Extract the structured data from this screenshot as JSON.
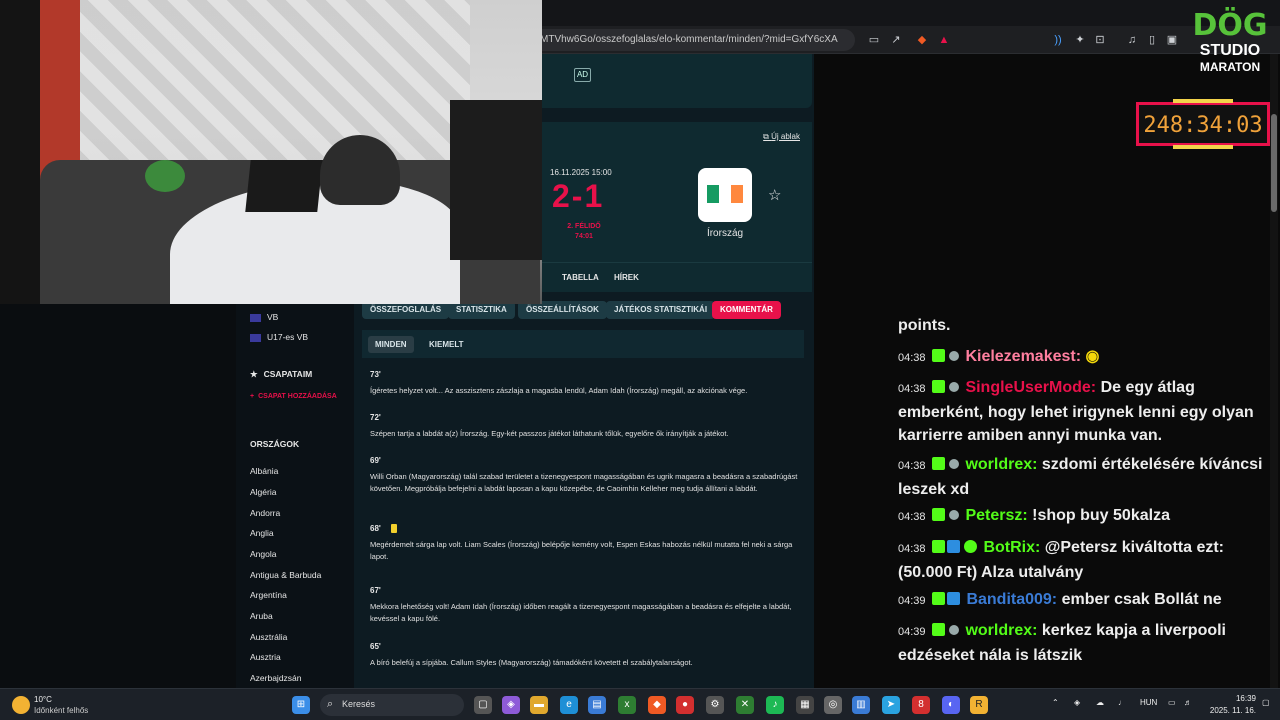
{
  "browser": {
    "url": "MTVhw6Go/osszefoglalas/elo-kommentar/minden/?mid=GxfY6cXA"
  },
  "ad": {
    "label": "AD"
  },
  "match": {
    "new_window": "Új ablak",
    "date": "16.11.2025 15:00",
    "score": "2-1",
    "period": "2. FÉLIDŐ",
    "clock": "74:01",
    "team": "Írország"
  },
  "subnav": [
    "TABELLA",
    "HÍREK"
  ],
  "tabs": [
    "ÖSSZEFOGLALÁS",
    "STATISZTIKA",
    "ÖSSZEÁLLÍTÁSOK",
    "JÁTÉKOS STATISZTIKÁI",
    "KOMMENTÁR"
  ],
  "filters": [
    "MINDEN",
    "KIEMELT"
  ],
  "commentary": [
    {
      "minute": "73'",
      "text": "Ígéretes helyzet volt... Az asszisztens zászlaja a magasba lendül, Adam Idah (Írország) megáll, az akciónak vége."
    },
    {
      "minute": "72'",
      "text": "Szépen tartja a labdát a(z) Írország. Egy-két passzos játékot láthatunk tőlük, egyelőre ők irányítják a játékot."
    },
    {
      "minute": "69'",
      "text": "Willi Orban (Magyarország) talál szabad területet a tizenegyespont magasságában és ugrik magasra a beadásra a szabadrúgást követően. Megpróbálja befejelni a labdát laposan a kapu közepébe, de Caoimhin Kelleher meg tudja állítani a labdát."
    },
    {
      "minute": "68'",
      "text": "Megérdemelt sárga lap volt. Liam Scales (Írország) belépője kemény volt, Espen Eskas habozás nélkül mutatta fel neki a sárga lapot."
    },
    {
      "minute": "67'",
      "text": "Mekkora lehetőség volt! Adam Idah (Írország) időben reagált a tizenegyespont magasságában a beadásra és elfejelte a labdát, kevéssel a kapu fölé."
    },
    {
      "minute": "65'",
      "text": "A bíró belefúj a sípjába. Callum Styles (Magyarország) támadóként követett el szabálytalanságot."
    }
  ],
  "sidebar": {
    "competitions": [
      "VB",
      "U17-es VB"
    ],
    "my_teams": "CSAPATAIM",
    "add_team": "CSAPAT HOZZÁADÁSA",
    "countries_header": "ORSZÁGOK",
    "countries": [
      "Albánia",
      "Algéria",
      "Andorra",
      "Anglia",
      "Angola",
      "Antigua & Barbuda",
      "Argentína",
      "Aruba",
      "Ausztrália",
      "Ausztria",
      "Azerbajdzsán"
    ]
  },
  "stream": {
    "logo": {
      "line1": "DÖG",
      "line2": "STUDIO",
      "line3": "MARATON"
    },
    "timer": "248:34:03"
  },
  "chat": [
    {
      "time": "",
      "user": "",
      "color": "#ffffff",
      "text": "points.",
      "badges": []
    },
    {
      "time": "04:38",
      "user": "Kielezemakest:",
      "color": "#ff7f9f",
      "text": "",
      "badges": [
        "kick",
        "dot"
      ]
    },
    {
      "time": "04:38",
      "user": "SingleUserMode:",
      "color": "#e8114a",
      "text": "De egy átlag emberként, hogy lehet irigynek lenni egy olyan karrierre amiben annyi munka van.",
      "badges": [
        "kick",
        "dot"
      ]
    },
    {
      "time": "04:38",
      "user": "worldrex:",
      "color": "#53fc18",
      "text": "szdomi értékelésére kíváncsi leszek xd",
      "badges": [
        "kick",
        "dot"
      ]
    },
    {
      "time": "04:38",
      "user": "Petersz:",
      "color": "#53fc18",
      "text": "!shop buy 50kalza",
      "badges": [
        "kick",
        "dot"
      ]
    },
    {
      "time": "04:38",
      "user": "BotRix:",
      "color": "#53fc18",
      "text": "@Petersz kiváltotta ezt: (50.000 Ft) Alza utalvány",
      "badges": [
        "kick",
        "blue",
        "gear"
      ]
    },
    {
      "time": "04:39",
      "user": "Bandita009:",
      "color": "#3a7bd5",
      "text": "ember csak Bollát ne",
      "badges": [
        "kick",
        "blue"
      ]
    },
    {
      "time": "04:39",
      "user": "worldrex:",
      "color": "#53fc18",
      "text": "kerkez kapja a liverpooli edzéseket nála is látszik",
      "badges": [
        "kick",
        "dot"
      ]
    }
  ],
  "taskbar": {
    "temp": "10°C",
    "weather": "Időnként felhős",
    "search": "Keresés",
    "lang": "HUN",
    "time": "16:39",
    "date": "2025. 11. 16."
  }
}
